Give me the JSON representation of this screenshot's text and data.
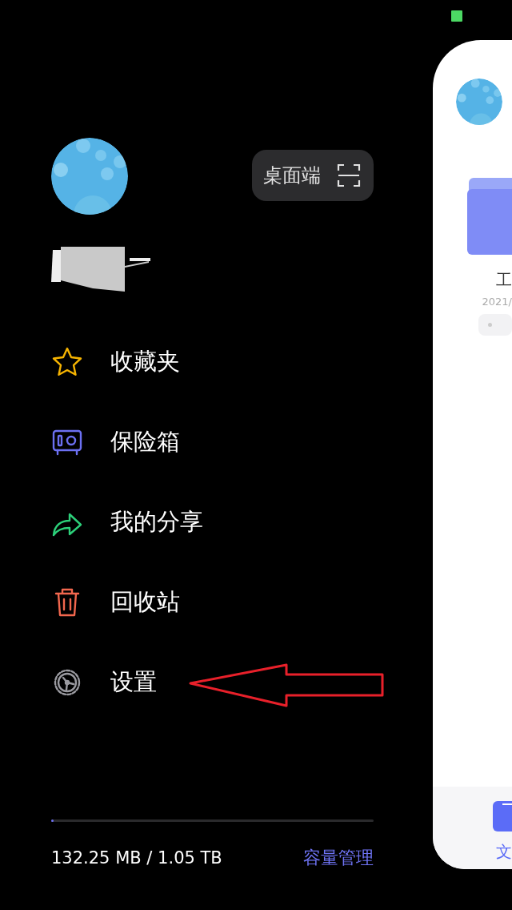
{
  "drawer": {
    "desktop_button": {
      "label": "桌面端"
    },
    "menu": [
      {
        "label": "收藏夹",
        "kind": "star",
        "color": "#f5b301"
      },
      {
        "label": "保险箱",
        "kind": "safe",
        "color": "#6c70f2"
      },
      {
        "label": "我的分享",
        "kind": "share",
        "color": "#2ccf79"
      },
      {
        "label": "回收站",
        "kind": "trash",
        "color": "#f2674e"
      },
      {
        "label": "设置",
        "kind": "gear",
        "color": "#9a9aa0"
      }
    ],
    "storage": {
      "level": 0.006,
      "usage": "132.25 MB / 1.05 TB",
      "manage_link": "容量管理"
    }
  },
  "main_panel": {
    "folder": {
      "name": "工",
      "date": "2021/"
    },
    "tab_bar": [
      {
        "label": "文",
        "selected": true
      }
    ]
  }
}
